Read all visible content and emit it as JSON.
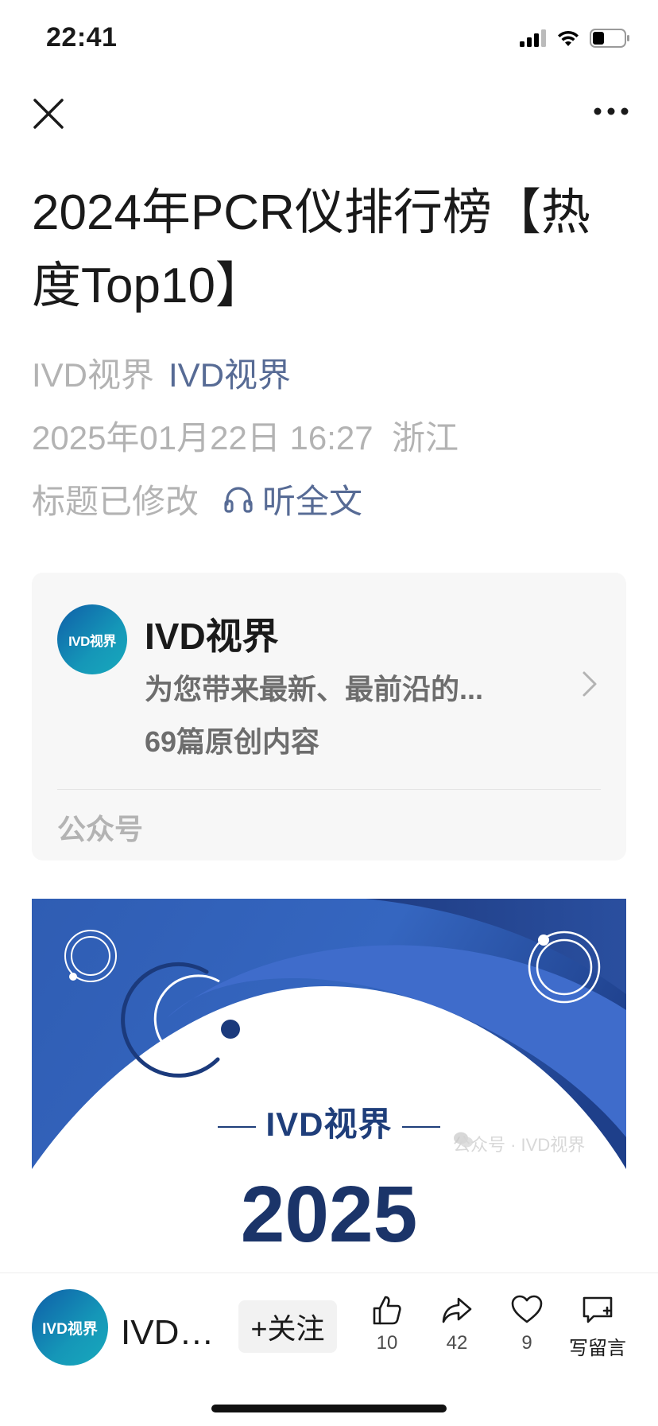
{
  "status_bar": {
    "time": "22:41"
  },
  "article": {
    "title": "2024年PCR仪排行榜【热度Top10】",
    "author": "IVD视界",
    "account_name": "IVD视界",
    "datetime": "2025年01月22日 16:27",
    "location": "浙江",
    "edited_label": "标题已修改",
    "listen_label": "听全文"
  },
  "account_card": {
    "avatar_text": "IVD视界",
    "name": "IVD视界",
    "description": "为您带来最新、最前沿的...",
    "original_count": "69篇原创内容",
    "type": "公众号"
  },
  "cover_image": {
    "brand": "IVD视界",
    "year": "2025",
    "watermark": "公众号 · IVD视界"
  },
  "bottom_bar": {
    "avatar_text": "IVD视界",
    "account_name": "IVD视界",
    "follow_label": "+关注",
    "like_count": "10",
    "share_count": "42",
    "favorite_count": "9",
    "comment_label": "写留言"
  },
  "colors": {
    "link": "#576b95",
    "meta": "#b3b3b3",
    "cover_blue": "#2d56a8",
    "cover_text": "#1f3e7a"
  },
  "icons": [
    "close-icon",
    "more-icon",
    "headphones-icon",
    "chevron-right-icon",
    "thumbs-up-icon",
    "share-icon",
    "heart-icon",
    "comment-icon"
  ]
}
